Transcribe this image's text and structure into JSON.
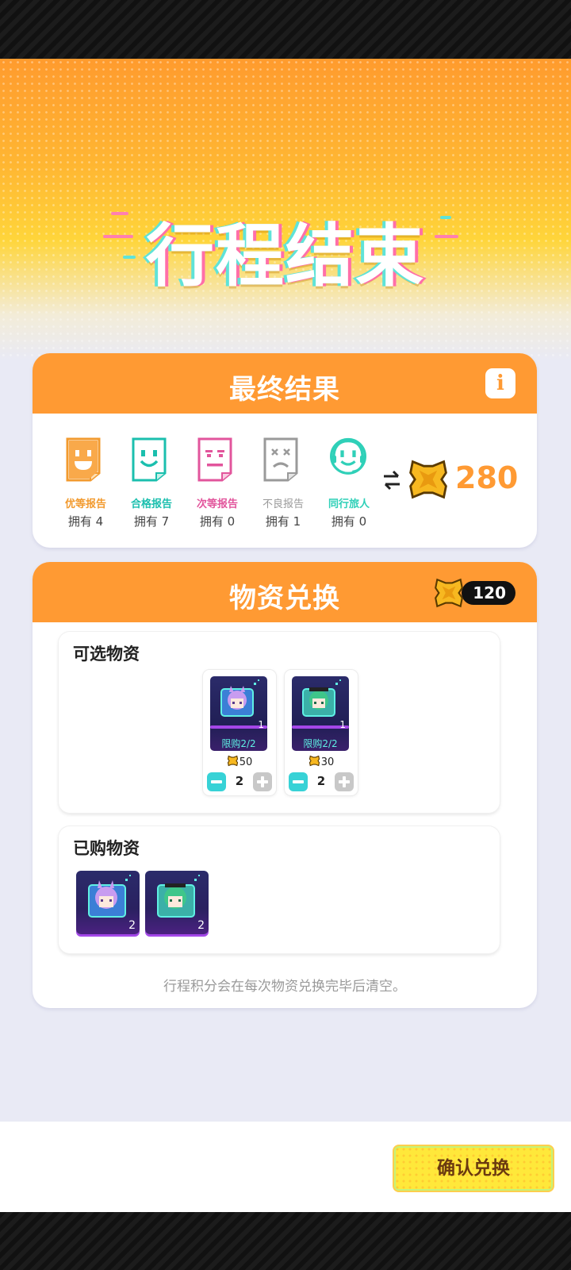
{
  "hero": {
    "title": "行程结束"
  },
  "result": {
    "title": "最终结果",
    "info_icon": "i",
    "reports": [
      {
        "label": "优等报告",
        "own": "拥有 4",
        "color": "#f29a2e",
        "face": "happy"
      },
      {
        "label": "合格报告",
        "own": "拥有 7",
        "color": "#1bbfae",
        "face": "smile"
      },
      {
        "label": "次等报告",
        "own": "拥有 0",
        "color": "#e2559c",
        "face": "flat"
      },
      {
        "label": "不良报告",
        "own": "拥有 1",
        "color": "#9a9a9a",
        "face": "dead"
      },
      {
        "label": "同行旅人",
        "own": "拥有 0",
        "color": "#2fd0b8",
        "face": "headset"
      }
    ],
    "exchange_icon": "exchange-arrows-icon",
    "total": "280"
  },
  "shop": {
    "title": "物资兑换",
    "balance": "120",
    "available": {
      "title": "可选物资",
      "items": [
        {
          "qty": "1",
          "limit": "限购2/2",
          "price": "50",
          "count": "2",
          "hair": "#c89cf0"
        },
        {
          "qty": "1",
          "limit": "限购2/2",
          "price": "30",
          "count": "2",
          "hair": "#3fc68a"
        }
      ]
    },
    "purchased": {
      "title": "已购物资",
      "items": [
        {
          "qty": "2",
          "hair": "#c89cf0"
        },
        {
          "qty": "2",
          "hair": "#3fc68a"
        }
      ]
    },
    "note": "行程积分会在每次物资兑换完毕后清空。"
  },
  "footer": {
    "confirm_label": "确认兑换"
  },
  "colors": {
    "accent": "#ff9a33",
    "teal": "#37d2d6",
    "yellow": "#ffe83a"
  }
}
